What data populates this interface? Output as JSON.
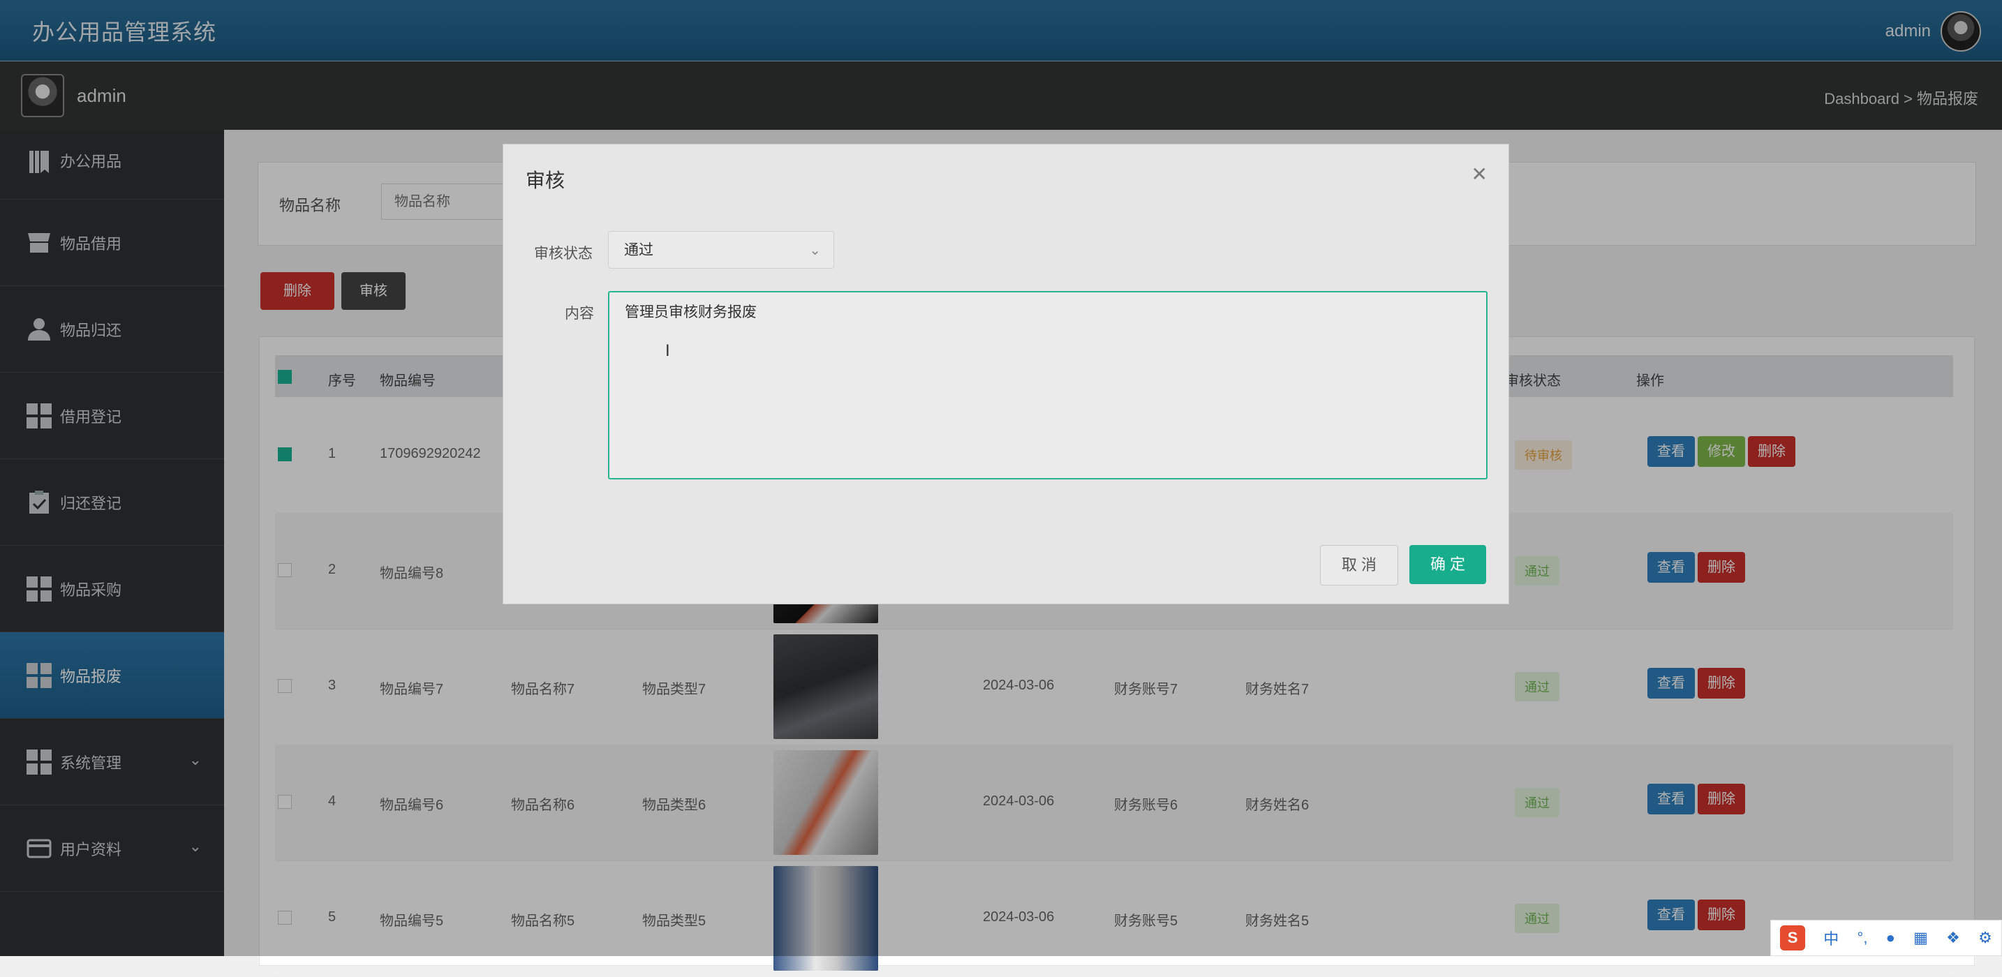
{
  "header": {
    "app_title": "办公用品管理系统",
    "user": "admin"
  },
  "subbar": {
    "user": "admin",
    "breadcrumb": "Dashboard > 物品报废"
  },
  "sidebar": {
    "items": [
      {
        "label": "办公用品",
        "icon": "book-icon"
      },
      {
        "label": "物品借用",
        "icon": "shop-icon"
      },
      {
        "label": "物品归还",
        "icon": "user-icon"
      },
      {
        "label": "借用登记",
        "icon": "grid-icon"
      },
      {
        "label": "归还登记",
        "icon": "clipboard-check-icon"
      },
      {
        "label": "物品采购",
        "icon": "grid-icon"
      },
      {
        "label": "物品报废",
        "icon": "grid-icon",
        "active": true
      },
      {
        "label": "系统管理",
        "icon": "grid-icon",
        "has_children": true
      },
      {
        "label": "用户资料",
        "icon": "card-icon",
        "has_children": true
      }
    ]
  },
  "filter": {
    "label": "物品名称",
    "placeholder": "物品名称"
  },
  "toolbar": {
    "delete_label": "删除",
    "audit_label": "审核"
  },
  "table": {
    "headers": {
      "index": "序号",
      "code": "物品编号",
      "audit_status": "审核状态",
      "actions": "操作"
    },
    "rows": [
      {
        "index": "1",
        "code": "1709692920242",
        "name": "",
        "type": "",
        "date": "",
        "account": "",
        "person": "",
        "status": "待审核",
        "checked": true,
        "editable": true
      },
      {
        "index": "2",
        "code": "物品编号8",
        "name": "",
        "type": "",
        "date": "",
        "account": "",
        "person": "",
        "status": "通过",
        "checked": false
      },
      {
        "index": "3",
        "code": "物品编号7",
        "name": "物品名称7",
        "type": "物品类型7",
        "date": "2024-03-06",
        "account": "财务账号7",
        "person": "财务姓名7",
        "status": "通过",
        "checked": false
      },
      {
        "index": "4",
        "code": "物品编号6",
        "name": "物品名称6",
        "type": "物品类型6",
        "date": "2024-03-06",
        "account": "财务账号6",
        "person": "财务姓名6",
        "status": "通过",
        "checked": false
      },
      {
        "index": "5",
        "code": "物品编号5",
        "name": "物品名称5",
        "type": "物品类型5",
        "date": "2024-03-06",
        "account": "财务账号5",
        "person": "财务姓名5",
        "status": "通过",
        "checked": false
      }
    ],
    "actions": {
      "view": "查看",
      "edit": "修改",
      "delete": "删除"
    }
  },
  "modal": {
    "title": "审核",
    "status_label": "审核状态",
    "status_value": "通过",
    "content_label": "内容",
    "content_value": "管理员审核财务报废",
    "cancel_label": "取 消",
    "ok_label": "确 定"
  },
  "ime": {
    "logo": "S",
    "lang": "中"
  },
  "colors": {
    "accent": "#1ab394",
    "header": "#1d5a82",
    "danger": "#c9302c",
    "primary": "#2f80bd"
  }
}
